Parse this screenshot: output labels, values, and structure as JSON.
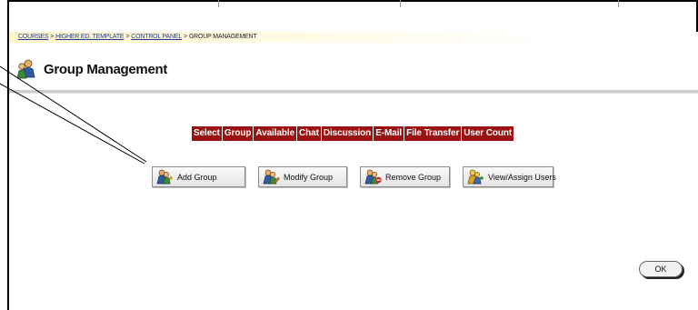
{
  "breadcrumb": {
    "items": [
      "COURSES",
      "HIGHER ED. TEMPLATE",
      "CONTROL PANEL"
    ],
    "separator": ">",
    "current": "GROUP MANAGEMENT"
  },
  "page": {
    "title": "Group Management",
    "title_icon": "group-people-icon"
  },
  "table": {
    "headers": [
      "Select",
      "Group",
      "Available",
      "Chat",
      "Discussion",
      "E-Mail",
      "File Transfer",
      "User Count"
    ],
    "header_color": "#9a1212"
  },
  "actions": {
    "add_label": "Add Group",
    "modify_label": "Modify Group",
    "remove_label": "Remove Group",
    "view_label": "View/Assign Users"
  },
  "footer": {
    "ok_label": "OK"
  },
  "colors": {
    "breadcrumb_bg": "#fff3c8",
    "link": "#1a3b9a"
  }
}
